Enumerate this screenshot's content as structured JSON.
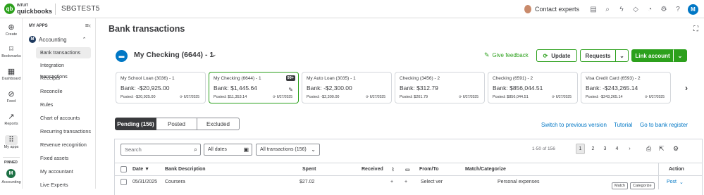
{
  "app": {
    "logo_small": "INTUIT",
    "logo_big": "quickbooks",
    "logo_mark": "qb",
    "company": "SBGTEST5"
  },
  "topbar": {
    "contact": "Contact experts",
    "user_initial": "M",
    "icons": [
      "clipboard-icon",
      "search-icon",
      "lightning-icon",
      "puzzle-icon",
      "bell-icon",
      "gear-icon",
      "help-icon"
    ]
  },
  "rail": {
    "items": [
      {
        "label": "Create",
        "icon": "plus-icon"
      },
      {
        "label": "Bookmarks",
        "icon": "bookmark-icon"
      },
      {
        "label": "Dashboard",
        "icon": "dashboard-icon"
      },
      {
        "label": "Feed",
        "icon": "feed-icon"
      },
      {
        "label": "Reports",
        "icon": "reports-icon"
      },
      {
        "label": "My apps",
        "icon": "apps-icon"
      }
    ],
    "pinned": "PINNED",
    "pinned_app": {
      "initial": "M",
      "label": "Accounting"
    }
  },
  "sidebar": {
    "heading": "MY APPS",
    "app_initial": "M",
    "app_name": "Accounting",
    "items": [
      "Bank transactions",
      "Integration transactions",
      "Receipts",
      "Reconcile",
      "Rules",
      "Chart of accounts",
      "Recurring transactions",
      "Revenue recognition",
      "Fixed assets",
      "My accountant",
      "Live Experts"
    ]
  },
  "page": {
    "title": "Bank transactions",
    "account": "My Checking (6644) - 1",
    "feedback": "Give feedback",
    "update": "Update",
    "requests": "Requests",
    "link": "Link account"
  },
  "cards": [
    {
      "name": "My School Loan (3036) - 1",
      "bank": "Bank: -$20,925.00",
      "posted": "Posted: -$20,925.00",
      "date": "6/27/2025"
    },
    {
      "name": "My Checking (6644) - 1",
      "bank": "Bank: $1,445.64",
      "posted": "Posted: $11,353.14",
      "date": "6/27/2025",
      "badge": "99+"
    },
    {
      "name": "My Auto Loan (3035) - 1",
      "bank": "Bank: -$2,300.00",
      "posted": "Posted: -$2,300.00",
      "date": "6/27/2025"
    },
    {
      "name": "Checking (3456) - 2",
      "bank": "Bank: $312.79",
      "posted": "Posted: $201.79",
      "date": "6/27/2025"
    },
    {
      "name": "Checking (6591) - 2",
      "bank": "Bank: $856,044.51",
      "posted": "Posted: $856,044.51",
      "date": "6/27/2025"
    },
    {
      "name": "Visa Credit Card (6593) - 2",
      "bank": "Bank: -$243,265.14",
      "posted": "Posted: -$243,265.14",
      "date": "6/27/2025"
    }
  ],
  "tabs": {
    "pending": "Pending (156)",
    "posted": "Posted",
    "excluded": "Excluded"
  },
  "links": {
    "switch": "Switch to previous version",
    "tutorial": "Tutorial",
    "register": "Go to bank register"
  },
  "filters": {
    "search_placeholder": "Search",
    "dates": "All dates",
    "txn": "All transactions (156)"
  },
  "pager": {
    "range": "1-50 of 156",
    "pages": [
      "1",
      "2",
      "3",
      "4"
    ]
  },
  "columns": {
    "date": "Date",
    "date_sort": "▼",
    "desc": "Bank Description",
    "spent": "Spent",
    "received": "Received",
    "fromto": "From/To",
    "match": "Match/Categorize",
    "action": "Action"
  },
  "row": {
    "date": "05/31/2025",
    "desc": "Coursera",
    "spent": "$27.02",
    "fromto": "Select ver",
    "category": "Personal expenses",
    "match_btn": "Match",
    "cat_btn": "Categorize",
    "post": "Post"
  }
}
